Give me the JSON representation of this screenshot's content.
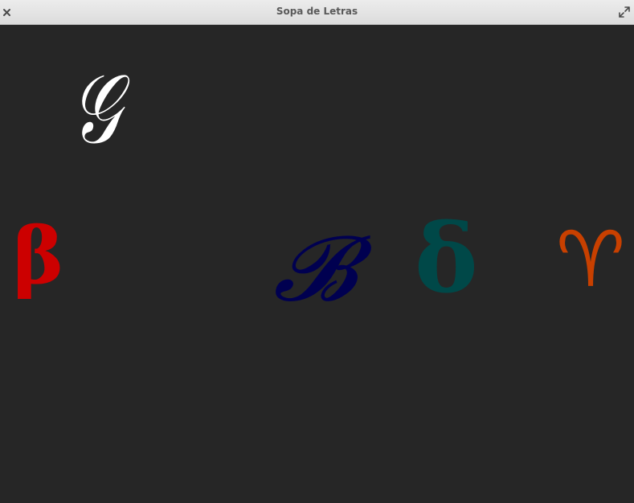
{
  "window": {
    "title": "Sopa de Letras",
    "close_icon": "close-icon",
    "maximize_icon": "maximize-icon"
  },
  "board": {
    "background": "#262626",
    "letters": [
      {
        "glyph": "𝒢",
        "name": "letter-calligraphic-g",
        "color": "#ffffff"
      },
      {
        "glyph": "β",
        "name": "letter-beta",
        "color": "#cc0000"
      },
      {
        "glyph": "𝓑",
        "name": "letter-calligraphic-b",
        "color": "#000050"
      },
      {
        "glyph": "δ",
        "name": "letter-delta",
        "color": "#004848"
      },
      {
        "glyph": "♈",
        "name": "letter-aries",
        "color": "#c84000"
      }
    ]
  }
}
